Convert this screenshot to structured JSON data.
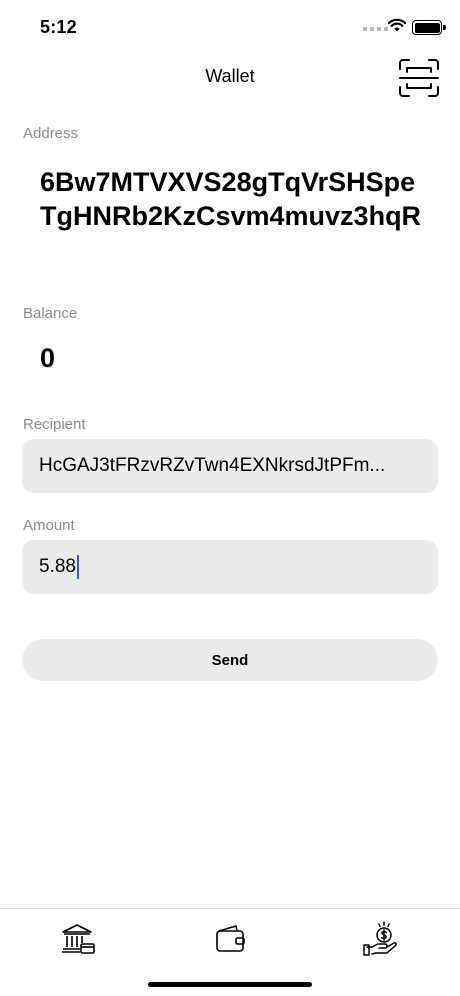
{
  "status_bar": {
    "time": "5:12"
  },
  "nav": {
    "title": "Wallet"
  },
  "address": {
    "label": "Address",
    "value": "6Bw7MTVXVS28gTqVrSHSpeTgHNRb2KzCsvm4muvz3hqR"
  },
  "balance": {
    "label": "Balance",
    "value": "0"
  },
  "recipient": {
    "label": "Recipient",
    "value": "HcGAJ3tFRzvRZvTwn4EXNkrsdJtPFm..."
  },
  "amount": {
    "label": "Amount",
    "value": "5.88"
  },
  "send_button": {
    "label": "Send"
  },
  "tabs": [
    {
      "icon": "bank-icon"
    },
    {
      "icon": "wallet-icon"
    },
    {
      "icon": "hand-money-icon"
    }
  ],
  "colors": {
    "field_bg": "#ebebeb",
    "label": "#8a8a8e",
    "caret": "#2f5bd6"
  }
}
